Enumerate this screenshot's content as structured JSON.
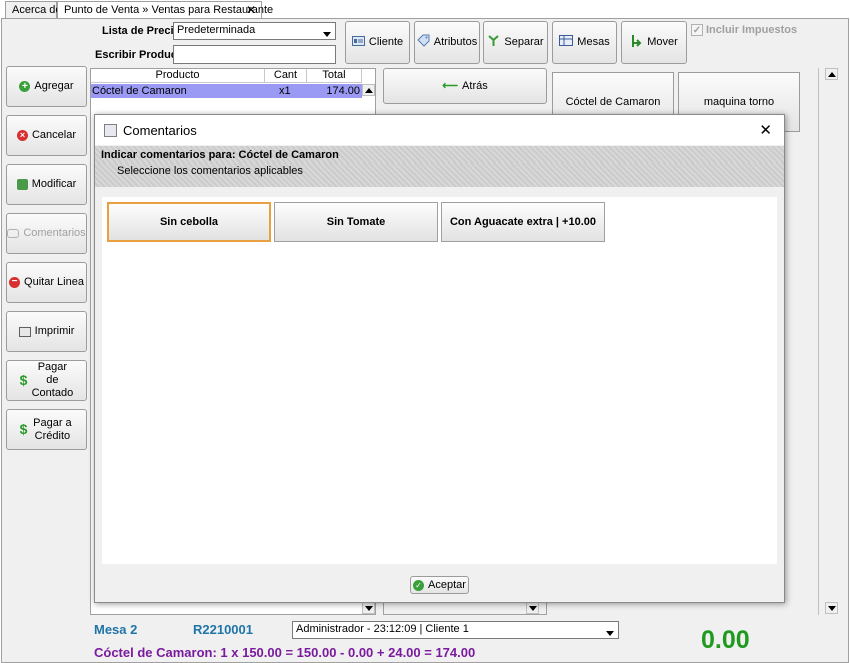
{
  "tabs": [
    {
      "label": "Acerca de"
    },
    {
      "label": "Punto de Venta » Ventas para Restaurante"
    }
  ],
  "form": {
    "price_list_label": "Lista de Precios",
    "price_list_value": "Predeterminada",
    "product_label": "Escribir Producto",
    "product_value": ""
  },
  "toolbar": {
    "cliente": "Cliente",
    "atributos": "Atributos",
    "separar": "Separar",
    "mesas": "Mesas",
    "mover": "Mover",
    "incluir_impuestos": "Incluir Impuestos"
  },
  "sidebar": {
    "agregar": "Agregar",
    "cancelar": "Cancelar",
    "modificar": "Modificar",
    "comentarios": "Comentarios",
    "quitar_linea": "Quitar Linea",
    "imprimir": "Imprimir",
    "pagar_contado": "Pagar de Contado",
    "pagar_credito": "Pagar a Crédito"
  },
  "grid": {
    "headers": [
      "Producto",
      "Cant",
      "Total"
    ],
    "rows": [
      {
        "producto": "Cóctel de Camaron",
        "cant": "x1",
        "total": "174.00"
      }
    ]
  },
  "categories": {
    "atras": "Atrás"
  },
  "products": [
    {
      "label": "Cóctel de Camaron"
    },
    {
      "label": "maquina torno"
    }
  ],
  "dialog": {
    "title": "Comentarios",
    "header": "Indicar comentarios para: Cóctel de Camaron",
    "subheader": "Seleccione los comentarios aplicables",
    "options": [
      {
        "label": "Sin cebolla"
      },
      {
        "label": "Sin Tomate"
      },
      {
        "label": "Con Aguacate extra | +10.00"
      }
    ],
    "accept": "Aceptar"
  },
  "footer": {
    "mesa": "Mesa 2",
    "folio": "R2210001",
    "session": "Administrador - 23:12:09 | Cliente 1",
    "total": "0.00",
    "summary": "Cóctel de Camaron: 1 x 150.00 = 150.00 - 0.00 + 24.00 = 174.00"
  },
  "colors": {
    "selected_row": "#9a9af5",
    "mesa_blue": "#1f74a8",
    "summary_purple": "#7a1a9e",
    "total_green": "#1e9a1e",
    "focus_border": "#e8a040"
  }
}
